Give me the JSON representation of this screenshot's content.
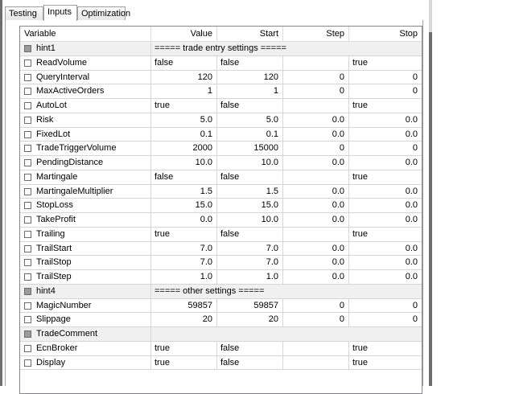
{
  "tabs": [
    {
      "label": "Testing",
      "active": false
    },
    {
      "label": "Inputs",
      "active": true
    },
    {
      "label": "Optimization",
      "active": false
    }
  ],
  "columns": [
    "Variable",
    "Value",
    "Start",
    "Step",
    "Stop"
  ],
  "rows": [
    {
      "name": "hint1",
      "hint": true,
      "text": "===== trade entry settings ====="
    },
    {
      "name": "ReadVolume",
      "value": "false",
      "start": "false",
      "step": "",
      "stop": "true",
      "type": "str"
    },
    {
      "name": "QueryInterval",
      "value": "120",
      "start": "120",
      "step": "0",
      "stop": "0",
      "type": "num"
    },
    {
      "name": "MaxActiveOrders",
      "value": "1",
      "start": "1",
      "step": "0",
      "stop": "0",
      "type": "num"
    },
    {
      "name": "AutoLot",
      "value": "true",
      "start": "false",
      "step": "",
      "stop": "true",
      "type": "str"
    },
    {
      "name": "Risk",
      "value": "5.0",
      "start": "5.0",
      "step": "0.0",
      "stop": "0.0",
      "type": "num"
    },
    {
      "name": "FixedLot",
      "value": "0.1",
      "start": "0.1",
      "step": "0.0",
      "stop": "0.0",
      "type": "num"
    },
    {
      "name": "TradeTriggerVolume",
      "value": "2000",
      "start": "15000",
      "step": "0",
      "stop": "0",
      "type": "num"
    },
    {
      "name": "PendingDistance",
      "value": "10.0",
      "start": "10.0",
      "step": "0.0",
      "stop": "0.0",
      "type": "num"
    },
    {
      "name": "Martingale",
      "value": "false",
      "start": "false",
      "step": "",
      "stop": "true",
      "type": "str"
    },
    {
      "name": "MartingaleMultiplier",
      "value": "1.5",
      "start": "1.5",
      "step": "0.0",
      "stop": "0.0",
      "type": "num"
    },
    {
      "name": "StopLoss",
      "value": "15.0",
      "start": "15.0",
      "step": "0.0",
      "stop": "0.0",
      "type": "num"
    },
    {
      "name": "TakeProfit",
      "value": "0.0",
      "start": "10.0",
      "step": "0.0",
      "stop": "0.0",
      "type": "num"
    },
    {
      "name": "Trailing",
      "value": "true",
      "start": "false",
      "step": "",
      "stop": "true",
      "type": "str"
    },
    {
      "name": "TrailStart",
      "value": "7.0",
      "start": "7.0",
      "step": "0.0",
      "stop": "0.0",
      "type": "num"
    },
    {
      "name": "TrailStop",
      "value": "7.0",
      "start": "7.0",
      "step": "0.0",
      "stop": "0.0",
      "type": "num"
    },
    {
      "name": "TrailStep",
      "value": "1.0",
      "start": "1.0",
      "step": "0.0",
      "stop": "0.0",
      "type": "num"
    },
    {
      "name": "hint4",
      "hint": true,
      "text": "===== other settings ====="
    },
    {
      "name": "MagicNumber",
      "value": "59857",
      "start": "59857",
      "step": "0",
      "stop": "0",
      "type": "num"
    },
    {
      "name": "Slippage",
      "value": "20",
      "start": "20",
      "step": "0",
      "stop": "0",
      "type": "num"
    },
    {
      "name": "TradeComment",
      "hint": true,
      "text": ""
    },
    {
      "name": "EcnBroker",
      "value": "true",
      "start": "false",
      "step": "",
      "stop": "true",
      "type": "str"
    },
    {
      "name": "Display",
      "value": "true",
      "start": "false",
      "step": "",
      "stop": "true",
      "type": "str"
    }
  ]
}
